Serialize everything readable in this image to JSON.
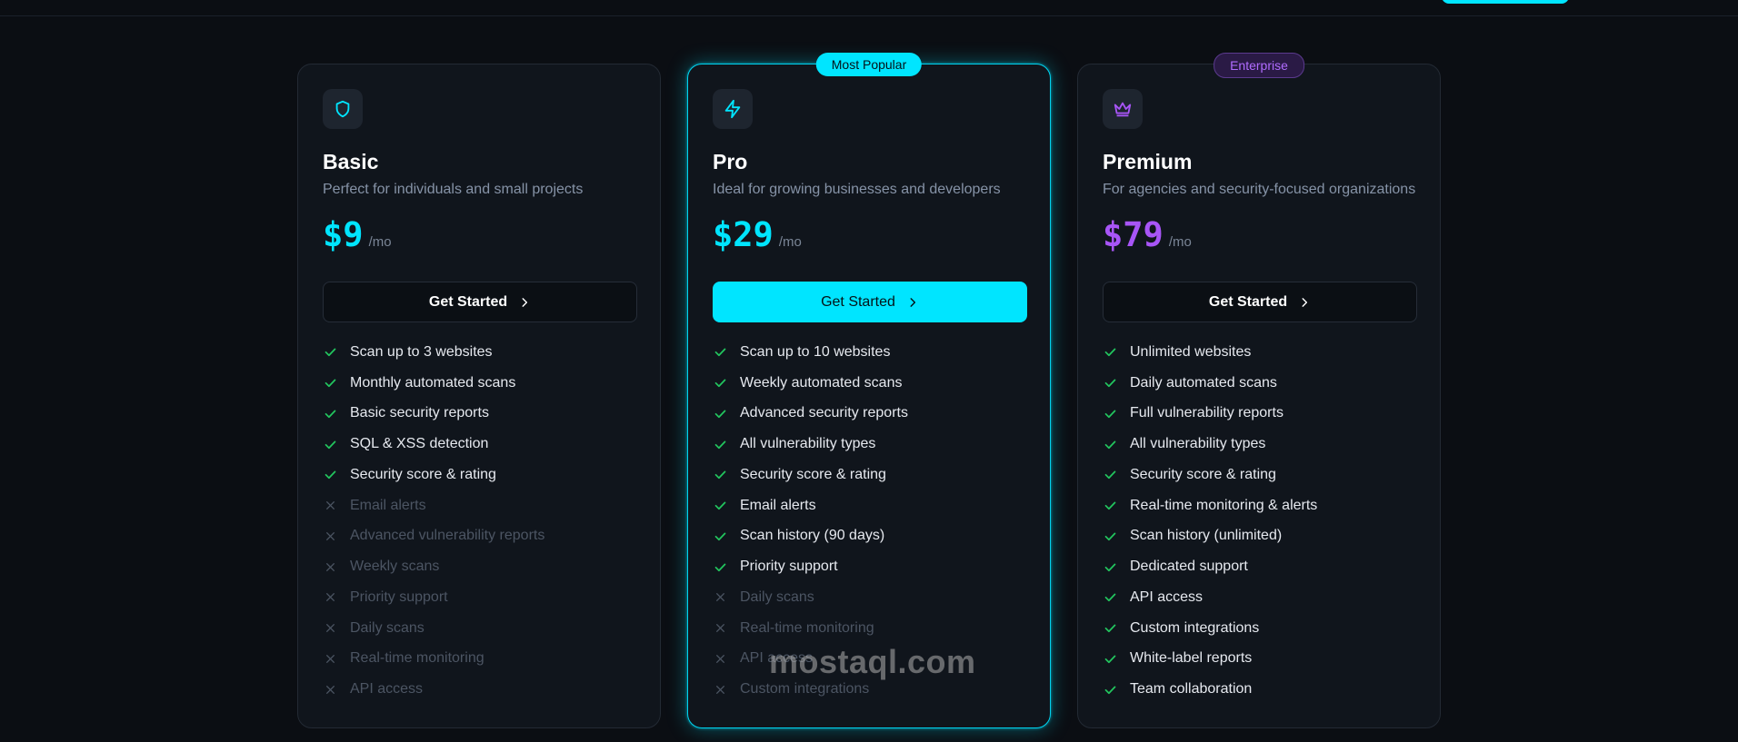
{
  "colors": {
    "accent": "#00e5ff",
    "premium_accent": "#a855f7",
    "check": "#22c55e",
    "cross": "#4c5563",
    "background": "#0b0e13"
  },
  "plans": [
    {
      "name": "Basic",
      "icon": "shield-icon",
      "description": "Perfect for individuals and small projects",
      "price": "$9",
      "period": "/mo",
      "cta": "Get Started",
      "badge": "",
      "features": [
        {
          "text": "Scan up to 3 websites",
          "included": true
        },
        {
          "text": "Monthly automated scans",
          "included": true
        },
        {
          "text": "Basic security reports",
          "included": true
        },
        {
          "text": "SQL & XSS detection",
          "included": true
        },
        {
          "text": "Security score & rating",
          "included": true
        },
        {
          "text": "Email alerts",
          "included": false
        },
        {
          "text": "Advanced vulnerability reports",
          "included": false
        },
        {
          "text": "Weekly scans",
          "included": false
        },
        {
          "text": "Priority support",
          "included": false
        },
        {
          "text": "Daily scans",
          "included": false
        },
        {
          "text": "Real-time monitoring",
          "included": false
        },
        {
          "text": "API access",
          "included": false
        }
      ]
    },
    {
      "name": "Pro",
      "icon": "lightning-icon",
      "description": "Ideal for growing businesses and developers",
      "price": "$29",
      "period": "/mo",
      "cta": "Get Started",
      "badge": "Most Popular",
      "features": [
        {
          "text": "Scan up to 10 websites",
          "included": true
        },
        {
          "text": "Weekly automated scans",
          "included": true
        },
        {
          "text": "Advanced security reports",
          "included": true
        },
        {
          "text": "All vulnerability types",
          "included": true
        },
        {
          "text": "Security score & rating",
          "included": true
        },
        {
          "text": "Email alerts",
          "included": true
        },
        {
          "text": "Scan history (90 days)",
          "included": true
        },
        {
          "text": "Priority support",
          "included": true
        },
        {
          "text": "Daily scans",
          "included": false
        },
        {
          "text": "Real-time monitoring",
          "included": false
        },
        {
          "text": "API access",
          "included": false
        },
        {
          "text": "Custom integrations",
          "included": false
        }
      ]
    },
    {
      "name": "Premium",
      "icon": "crown-icon",
      "description": "For agencies and security-focused organizations",
      "price": "$79",
      "period": "/mo",
      "cta": "Get Started",
      "badge": "Enterprise",
      "features": [
        {
          "text": "Unlimited websites",
          "included": true
        },
        {
          "text": "Daily automated scans",
          "included": true
        },
        {
          "text": "Full vulnerability reports",
          "included": true
        },
        {
          "text": "All vulnerability types",
          "included": true
        },
        {
          "text": "Security score & rating",
          "included": true
        },
        {
          "text": "Real-time monitoring & alerts",
          "included": true
        },
        {
          "text": "Scan history (unlimited)",
          "included": true
        },
        {
          "text": "Dedicated support",
          "included": true
        },
        {
          "text": "API access",
          "included": true
        },
        {
          "text": "Custom integrations",
          "included": true
        },
        {
          "text": "White-label reports",
          "included": true
        },
        {
          "text": "Team collaboration",
          "included": true
        }
      ]
    }
  ],
  "watermark": "mostaql.com"
}
